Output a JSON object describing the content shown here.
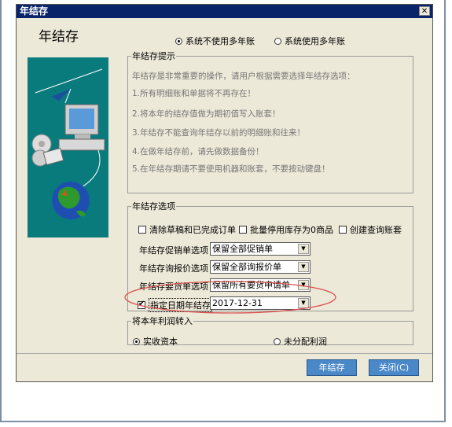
{
  "window": {
    "title": "年结存",
    "close_symbol": "✕"
  },
  "header": {
    "title": "年结存"
  },
  "mode_options": [
    {
      "label": "系统不使用多年账",
      "selected": true
    },
    {
      "label": "系统使用多年账",
      "selected": false
    }
  ],
  "tips": {
    "legend": "年结存提示",
    "lines": [
      "年结存是非常重要的操作，请用户根据需要选择年结存选项：",
      "1.所有明细账和单据将不再存在！",
      "2.将本年的结存值做为期初值写入账套！",
      "3.年结存不能查询年结存以前的明细账和往来！",
      "4.在做年结存前，请先做数据备份！",
      "5.在年结存期请不要使用机器和账套，不要按动键盘！"
    ]
  },
  "options": {
    "legend": "年结存选项",
    "checkboxes": [
      {
        "label": "清除草稿和已完成订单",
        "checked": false
      },
      {
        "label": "批量停用库存为0商品",
        "checked": false
      },
      {
        "label": "创建查询账套",
        "checked": false
      }
    ],
    "rows": [
      {
        "label": "年结存促销单选项",
        "value": "保留全部促销单"
      },
      {
        "label": "年结存询报价选项",
        "value": "保留全部询报价单"
      },
      {
        "label": "年结存要货单选项",
        "value": "保留所有要货申请单"
      }
    ],
    "date_row": {
      "label": "指定日期年结存",
      "checked": true,
      "value": "2017-12-31"
    }
  },
  "profit": {
    "legend": "将本年利润转入",
    "options": [
      {
        "label": "实收资本",
        "selected": true
      },
      {
        "label": "未分配利润",
        "selected": false
      }
    ]
  },
  "buttons": {
    "confirm": "年结存",
    "close": "关闭(C)"
  },
  "colors": {
    "titlebar": "#0a246a",
    "dialog_bg": "#ece9d8",
    "illustration_bg": "#0a7b7d",
    "button": "#4a88c8",
    "annotation": "#d9534f"
  },
  "annotation_icon": "red-ellipse-annotation"
}
